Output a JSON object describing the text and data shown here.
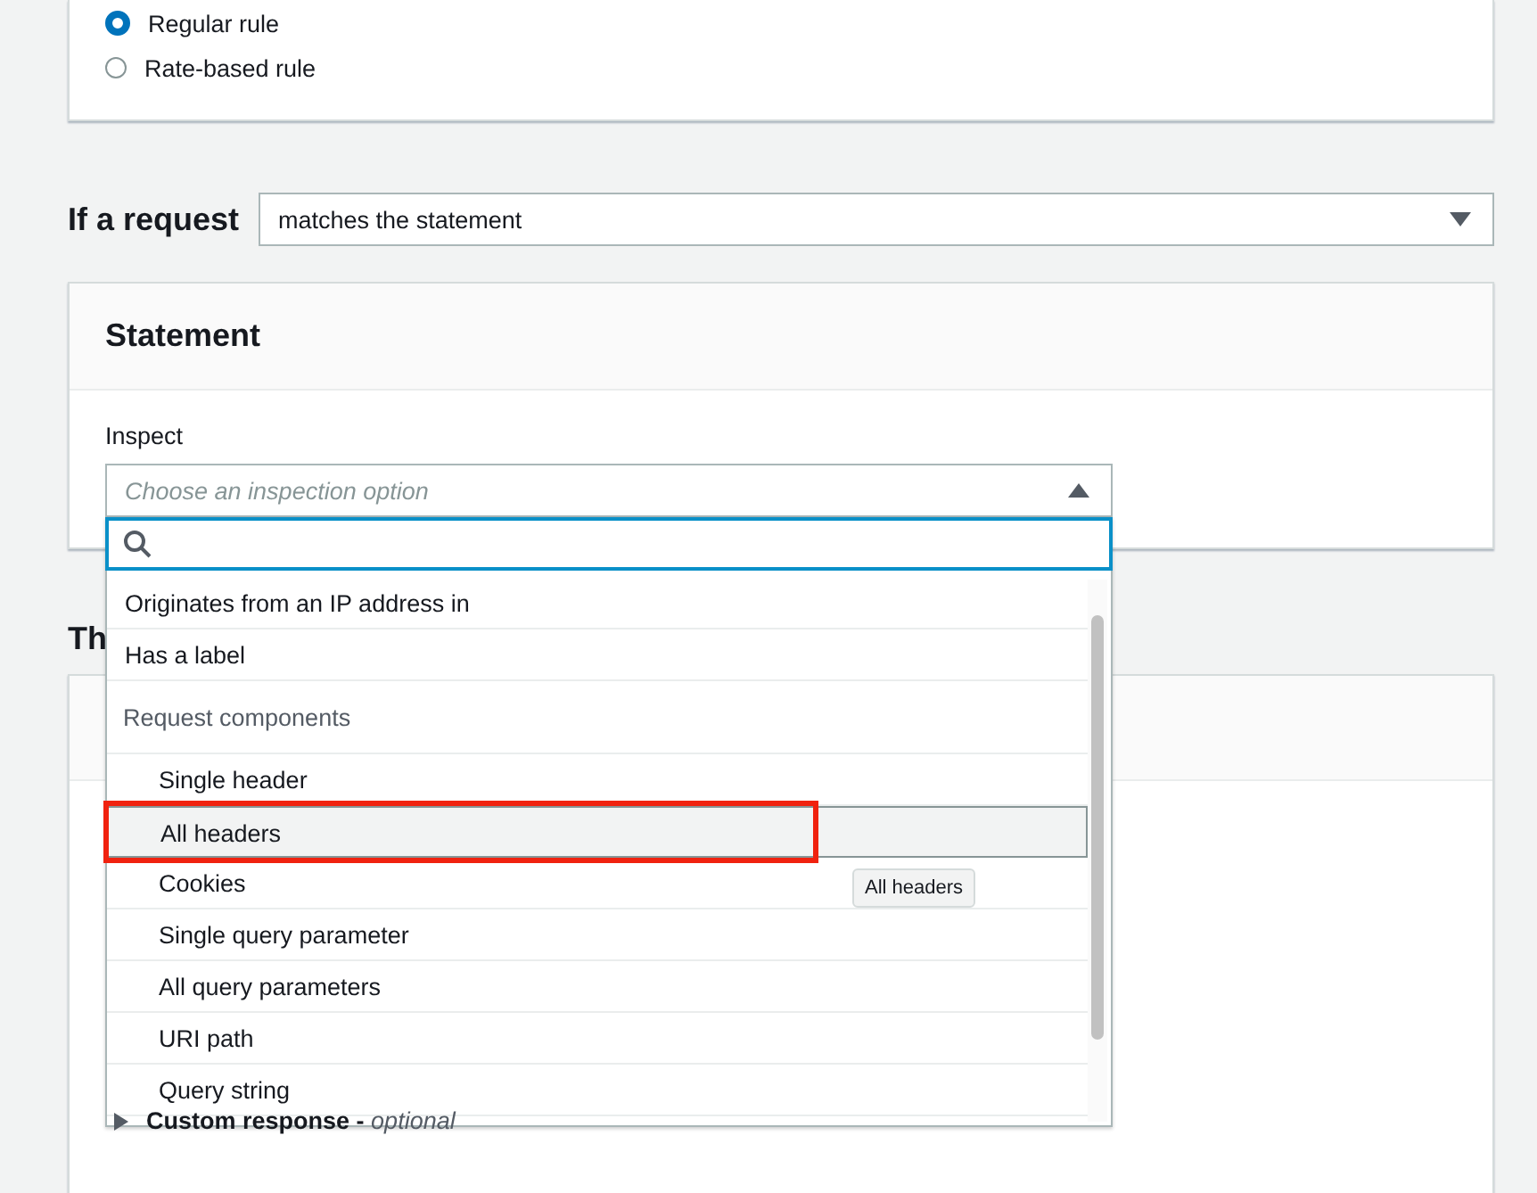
{
  "rule_type": [
    {
      "label": "Regular rule",
      "selected": true
    },
    {
      "label": "Rate-based rule",
      "selected": false
    }
  ],
  "condition": {
    "label": "If a request",
    "value": "matches the statement"
  },
  "statement": {
    "title": "Statement",
    "inspect": {
      "label": "Inspect",
      "placeholder": "Choose an inspection option",
      "expanded": true,
      "options": [
        {
          "kind": "option",
          "label": "Originates from an IP address in",
          "highlighted": false,
          "annotated": false
        },
        {
          "kind": "option",
          "label": "Has a label",
          "highlighted": false,
          "annotated": false
        },
        {
          "kind": "group",
          "label": "Request components"
        },
        {
          "kind": "child",
          "label": "Single header",
          "highlighted": false,
          "annotated": false
        },
        {
          "kind": "child",
          "label": "All headers",
          "highlighted": true,
          "annotated": true
        },
        {
          "kind": "child",
          "label": "Cookies",
          "highlighted": false,
          "annotated": false
        },
        {
          "kind": "child",
          "label": "Single query parameter",
          "highlighted": false,
          "annotated": false
        },
        {
          "kind": "child",
          "label": "All query parameters",
          "highlighted": false,
          "annotated": false
        },
        {
          "kind": "child",
          "label": "URI path",
          "highlighted": false,
          "annotated": false
        },
        {
          "kind": "child",
          "label": "Query string",
          "highlighted": false,
          "annotated": false
        }
      ],
      "tooltip": "All headers"
    }
  },
  "next_section": {
    "title": "Th",
    "custom_response": {
      "label": "**Custom response -** *optional*",
      "expanded": false
    }
  }
}
